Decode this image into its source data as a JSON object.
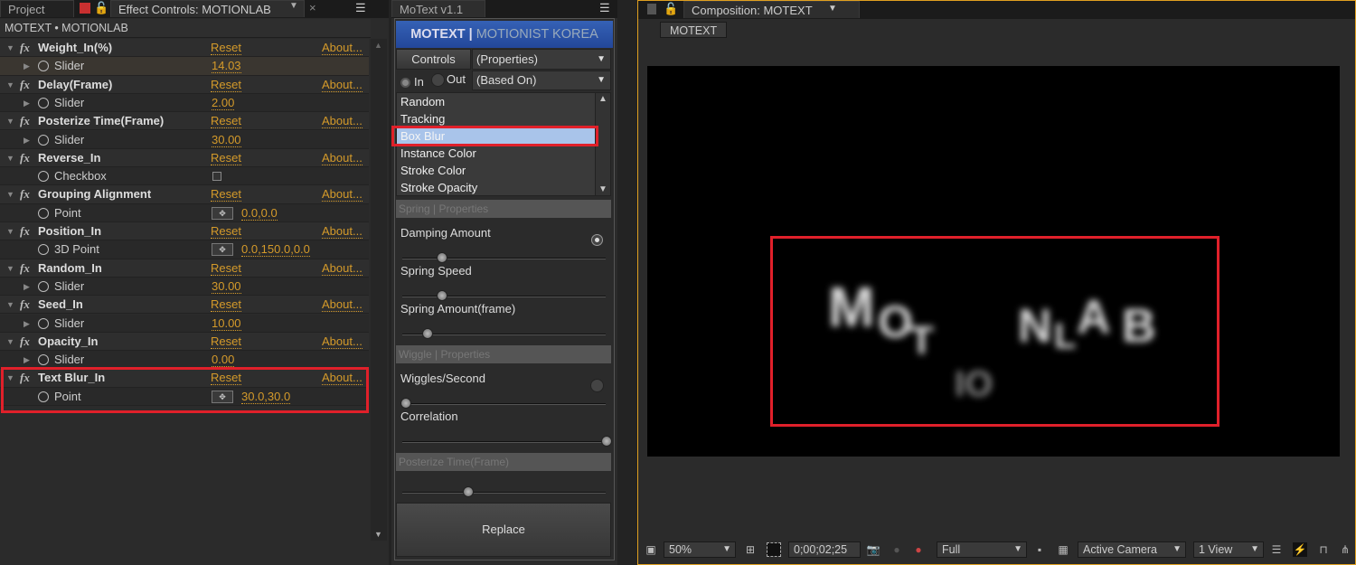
{
  "left": {
    "tabs": {
      "project": "Project",
      "effect_controls": "Effect Controls: MOTIONLAB"
    },
    "breadcrumb": "MOTEXT • MOTIONLAB",
    "reset_label": "Reset",
    "about_label": "About...",
    "effects": [
      {
        "name": "Weight_In(%)",
        "prop": "Slider",
        "type": "value",
        "value": "14.03"
      },
      {
        "name": "Delay(Frame)",
        "prop": "Slider",
        "type": "value",
        "value": "2.00"
      },
      {
        "name": "Posterize Time(Frame)",
        "prop": "Slider",
        "type": "value",
        "value": "30.00"
      },
      {
        "name": "Reverse_In",
        "prop": "Checkbox",
        "type": "checkbox",
        "value": ""
      },
      {
        "name": "Grouping Alignment",
        "prop": "Point",
        "type": "point",
        "value": "0.0,0.0"
      },
      {
        "name": "Position_In",
        "prop": "3D Point",
        "type": "point",
        "value": "0.0,150.0,0.0"
      },
      {
        "name": "Random_In",
        "prop": "Slider",
        "type": "value",
        "value": "30.00"
      },
      {
        "name": "Seed_In",
        "prop": "Slider",
        "type": "value",
        "value": "10.00"
      },
      {
        "name": "Opacity_In",
        "prop": "Slider",
        "type": "value",
        "value": "0.00"
      },
      {
        "name": "Text Blur_In",
        "prop": "Point",
        "type": "point",
        "value": "30.0,30.0"
      }
    ]
  },
  "mid": {
    "tab": "MoText v1.1",
    "banner_bold": "MOTEXT |",
    "banner_light": " MOTIONIST KOREA",
    "controls_label": "Controls",
    "properties_value": "(Properties)",
    "in_label": "In",
    "out_label": "Out",
    "based_on_value": "(Based On)",
    "list": [
      "Random",
      "Tracking",
      "Box Blur",
      "Instance Color",
      "Stroke Color",
      "Stroke Opacity"
    ],
    "selected": "Box Blur",
    "spring_header": "Spring | Properties",
    "damping": "Damping Amount",
    "spring_speed": "Spring Speed",
    "spring_amount": "Spring Amount(frame)",
    "wiggle_header": "Wiggle | Properties",
    "wiggles": "Wiggles/Second",
    "correlation": "Correlation",
    "posterize_header": "Posterize Time(Frame)",
    "replace_label": "Replace"
  },
  "right": {
    "tab": "Composition: MOTEXT",
    "comp_button": "MOTEXT",
    "preview_text": "MOTIONLAB",
    "toolbar": {
      "zoom": "50%",
      "timecode": "0;00;02;25",
      "resolution": "Full",
      "camera": "Active Camera",
      "views": "1 View"
    }
  },
  "colors": {
    "accent": "#d49a2a",
    "highlight": "#e0202a",
    "banner": "#2a4fa0"
  }
}
